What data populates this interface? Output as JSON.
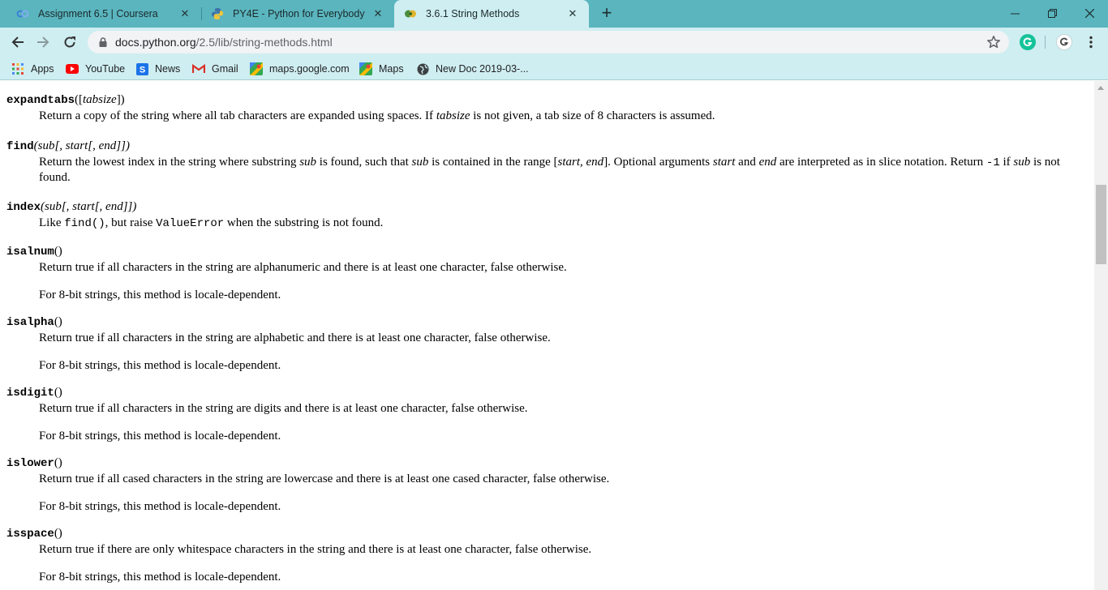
{
  "tabs": [
    {
      "title": "Assignment 6.5 | Coursera",
      "favicon": "coursera-icon",
      "active": false
    },
    {
      "title": "PY4E - Python for Everybody",
      "favicon": "python-icon",
      "active": false
    },
    {
      "title": "3.6.1 String Methods",
      "favicon": "python-docs-icon",
      "active": true
    }
  ],
  "toolbar": {
    "url_host": "docs.python.org",
    "url_path": "/2.5/lib/string-methods.html"
  },
  "bookmarks": [
    {
      "label": "Apps",
      "icon": "apps-grid-icon"
    },
    {
      "label": "YouTube",
      "icon": "youtube-icon"
    },
    {
      "label": "News",
      "icon": "news-icon"
    },
    {
      "label": "Gmail",
      "icon": "gmail-icon"
    },
    {
      "label": "maps.google.com",
      "icon": "maps-icon"
    },
    {
      "label": "Maps",
      "icon": "maps-icon"
    },
    {
      "label": "New Doc 2019-03-...",
      "icon": "globe-icon"
    }
  ],
  "doc": {
    "expandtabs": {
      "name": "expandtabs",
      "open": "([",
      "param": "tabsize",
      "close": "])",
      "d1": "Return a copy of the string where all tab characters are expanded using spaces. If ",
      "d2": "tabsize",
      "d3": " is not given, a tab size of 8 characters is assumed."
    },
    "find": {
      "name": "find",
      "signature": "(sub[, start[, end]])",
      "d1": "Return the lowest index in the string where substring ",
      "d2": "sub",
      "d3": " is found, such that ",
      "d4": "sub",
      "d5": " is contained in the range [",
      "d6": "start, end",
      "d7": "]. Optional arguments ",
      "d8": "start",
      "d9": " and ",
      "d10": "end",
      "d11": " are interpreted as in slice notation. Return ",
      "d12": "-1",
      "d13": " if ",
      "d14": "sub",
      "d15": " is not found."
    },
    "index": {
      "name": "index",
      "signature": "(sub[, start[, end]])",
      "d1": "Like ",
      "d2": "find()",
      "d3": ", but raise ",
      "d4": "ValueError",
      "d5": " when the substring is not found."
    },
    "locale_note": "For 8-bit strings, this method is locale-dependent.",
    "isalnum": {
      "name": "isalnum",
      "signature": "()",
      "desc": "Return true if all characters in the string are alphanumeric and there is at least one character, false otherwise."
    },
    "isalpha": {
      "name": "isalpha",
      "signature": "()",
      "desc": "Return true if all characters in the string are alphabetic and there is at least one character, false otherwise."
    },
    "isdigit": {
      "name": "isdigit",
      "signature": "()",
      "desc": "Return true if all characters in the string are digits and there is at least one character, false otherwise."
    },
    "islower": {
      "name": "islower",
      "signature": "()",
      "desc": "Return true if all cased characters in the string are lowercase and there is at least one cased character, false otherwise."
    },
    "isspace": {
      "name": "isspace",
      "signature": "()",
      "desc": "Return true if there are only whitespace characters in the string and there is at least one character, false otherwise."
    }
  }
}
